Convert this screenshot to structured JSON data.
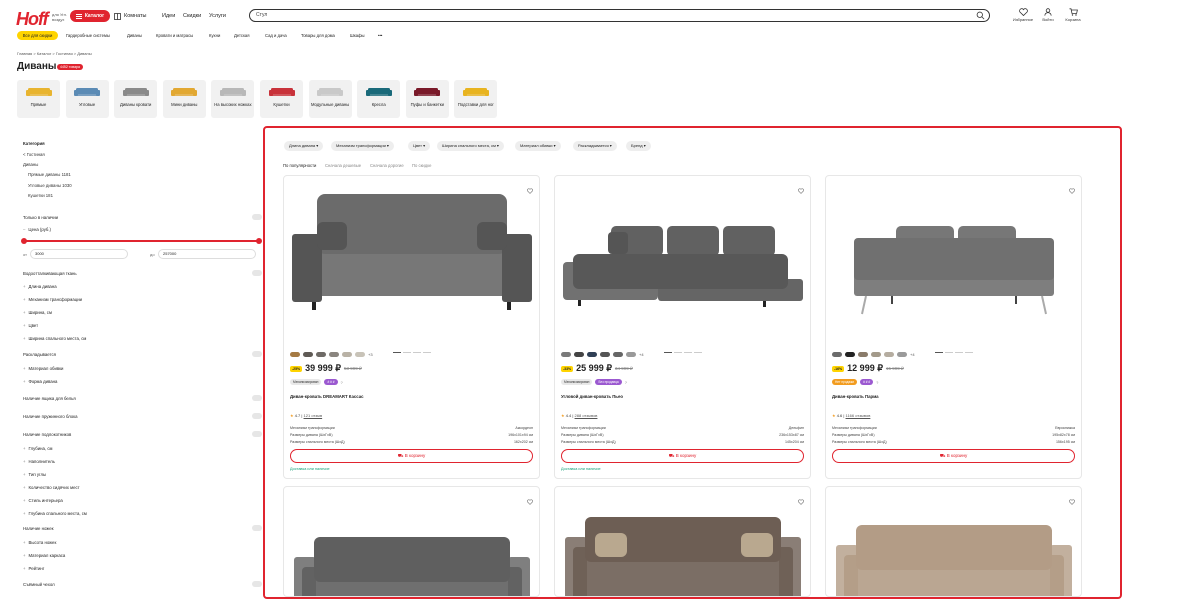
{
  "header": {
    "logo": "Hoff",
    "logo_sub": "для Угл. воздух",
    "catalog_label": "Каталог",
    "rooms_label": "Комнаты",
    "nav": [
      "Идеи",
      "Скидки",
      "Услуги"
    ],
    "search_placeholder": "Стул",
    "icons": [
      {
        "name": "favorites-icon",
        "label": "Избранное",
        "badge": "0"
      },
      {
        "name": "profile-icon",
        "label": "Войти"
      },
      {
        "name": "cart-icon",
        "label": "Корзина",
        "badge": "0"
      }
    ]
  },
  "categories": [
    "Все для скидки",
    "Гардеробные системы",
    "Диваны",
    "Кровати и матрасы",
    "Кухни",
    "Детская",
    "Сад и дача",
    "Товары для дома",
    "Шкафы",
    "•••"
  ],
  "breadcrumb": "Главная  >  Каталог  >  Гостиная  >  Диваны",
  "page_title": "Диваны",
  "title_badge": "4452 товара",
  "subcategories": [
    {
      "label": "Прямые",
      "color": "#e8b42f"
    },
    {
      "label": "Угловые",
      "color": "#5b8bb5"
    },
    {
      "label": "Диваны кровати",
      "color": "#8a8a8a"
    },
    {
      "label": "Мини диваны",
      "color": "#e2a832"
    },
    {
      "label": "На высоких ножках",
      "color": "#b8b8b8"
    },
    {
      "label": "Кушетки",
      "color": "#c8323a"
    },
    {
      "label": "Модульные диваны",
      "color": "#c9c9c9"
    },
    {
      "label": "Кресла",
      "color": "#1a6a7a"
    },
    {
      "label": "Пуфы и банкетки",
      "color": "#7a1a2a"
    },
    {
      "label": "Подставки для ног",
      "color": "#e8b420"
    }
  ],
  "sidebar": {
    "category_title": "Категория",
    "cat_items": [
      "< Гостиная",
      "Диваны"
    ],
    "cat_sub": [
      "Прямые диваны  1181",
      "Угловые диваны  1030",
      "Кушетки  181"
    ],
    "in_stock": "Только в наличии",
    "price_label": "Цена (руб.)",
    "price_from_prefix": "от",
    "price_to_prefix": "до",
    "price_from": "3000",
    "price_to": "257000",
    "waterproof": "Водоотталкивающая ткань",
    "group1": [
      "Длина дивана",
      "Механизм трансформации",
      "Ширина, см",
      "Цвет",
      "Ширина спального места, см"
    ],
    "unfoldable": "Раскладывается",
    "group2": [
      "Материал обивки",
      "Форма дивана"
    ],
    "linen_box": "Наличие ящика для белья",
    "spring_block": "Наличие пружинного блока",
    "armrests": "Наличие подлокотников",
    "group3": [
      "Глубина, см",
      "Наполнитель",
      "Тип углы",
      "Количество сидячих мест",
      "Стиль интерьера",
      "Глубина спального места, см"
    ],
    "legs": "Наличие ножек",
    "group4": [
      "Высота ножек",
      "Материал каркаса",
      "Рейтинг"
    ],
    "removable_cover": "Съёмный чехол"
  },
  "filters": [
    "Длина дивана",
    "Механизм трансформации",
    "Цвет",
    "Ширина спального места, см",
    "Материал обивки",
    "Раскладывается",
    "Бренд"
  ],
  "sort": [
    "По популярности",
    "Сначала дешевые",
    "Сначала дорогие",
    "По скидке"
  ],
  "cards": [
    {
      "swatches": [
        "#a57a43",
        "#5f5a55",
        "#6e6a66",
        "#8a857f",
        "#b9b2a6",
        "#c8c3b8"
      ],
      "more": "+3",
      "discount": "-25%",
      "price": "39 999 ₽",
      "old_price": "53 999 ₽",
      "tags": [
        {
          "text": "Механизмирован",
          "kind": "grey"
        },
        {
          "text": "# # #",
          "kind": "purple"
        }
      ],
      "name": "Диван-кровать DREAMART Кассас",
      "rating": "4.7",
      "reviews": "121 отзыв",
      "specs": [
        {
          "k": "Механизм трансформации",
          "v": "Аккордеон"
        },
        {
          "k": "Размеры дивана (ШхГхВ)",
          "v": "196х101х94 см"
        },
        {
          "k": "Размеры спального места (ШхД)",
          "v": "162х202 см"
        }
      ],
      "sofa_color": "#6b6b6b",
      "cart": "В корзину",
      "delivery": "Доставка или наличие"
    },
    {
      "swatches": [
        "#7a7a7a",
        "#444444",
        "#2f3f55",
        "#555555",
        "#666666",
        "#999999"
      ],
      "more": "+4",
      "discount": "-33%",
      "price": "25 999 ₽",
      "old_price": "34 999 ₽",
      "tags": [
        {
          "text": "Механизмирован",
          "kind": "grey"
        },
        {
          "text": "Без продавца",
          "kind": "purple"
        }
      ],
      "name": "Угловой диван-кровать Пьео",
      "rating": "4.4",
      "reviews": "288 отзывов",
      "specs": [
        {
          "k": "Механизм трансформации",
          "v": "Дельфин"
        },
        {
          "k": "Размеры дивана (ШхГхВ)",
          "v": "236х153х87 см"
        },
        {
          "k": "Размеры спального места (ШхД)",
          "v": "145х204 см"
        }
      ],
      "sofa_color": "#585858",
      "cart": "В корзину",
      "delivery": "Доставка или наличие"
    },
    {
      "swatches": [
        "#6b6b6b",
        "#222222",
        "#8a7b6a",
        "#a39a8a",
        "#b5ada0",
        "#9a9a9a"
      ],
      "more": "+4",
      "discount": "-16%",
      "price": "12 999 ₽",
      "old_price": "15 999 ₽",
      "tags": [
        {
          "text": "Нет продажи",
          "kind": "orange"
        },
        {
          "text": "# # #",
          "kind": "purple"
        }
      ],
      "name": "Диван-кровать Парма",
      "rating": "4.6",
      "reviews": "1166 отзывов",
      "specs": [
        {
          "k": "Механизм трансформации",
          "v": "Еврокнижка"
        },
        {
          "k": "Размеры дивана (ШхГхВ)",
          "v": "195х82х78 см"
        },
        {
          "k": "Размеры спального места (ШхД)",
          "v": "156х195 см"
        }
      ],
      "sofa_color": "#707070",
      "cart": "В корзину",
      "delivery": ""
    }
  ],
  "colors": {
    "accent": "#e0242f",
    "yellow": "#ffd400",
    "green": "#16a37a"
  }
}
